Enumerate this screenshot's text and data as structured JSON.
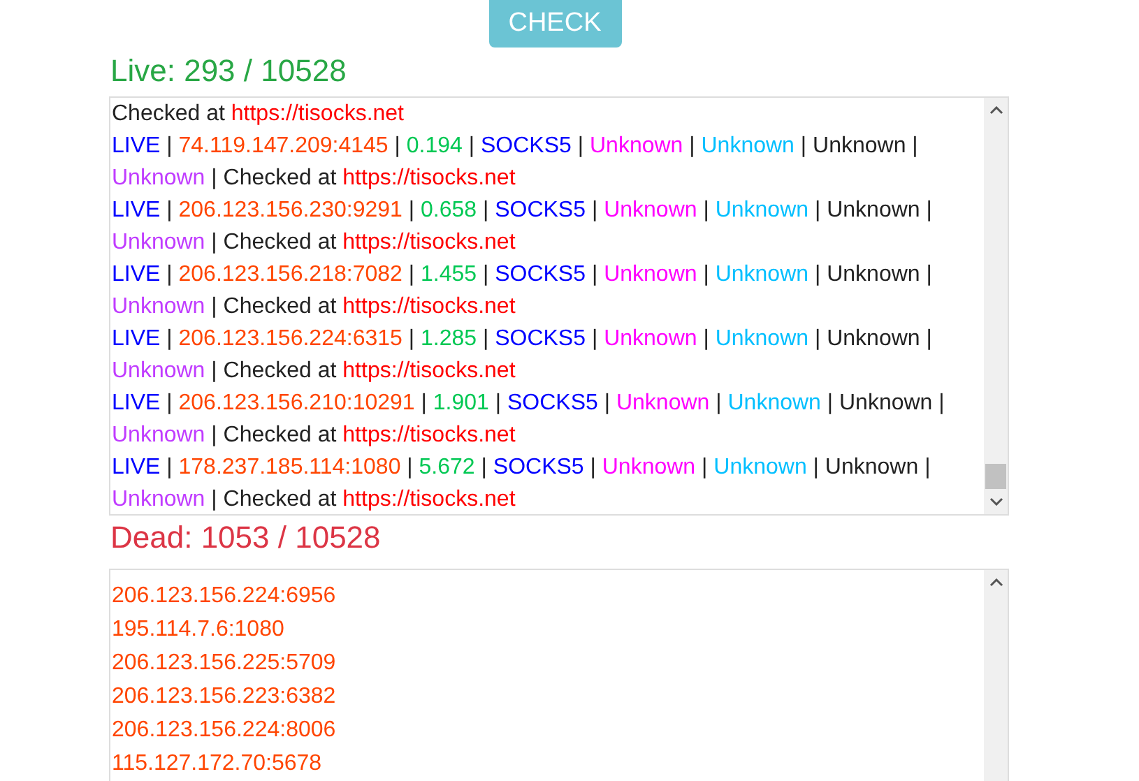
{
  "check_button": "CHECK",
  "live": {
    "heading": "Live: 293 / 10528",
    "separator": "|",
    "partial_tail": {
      "checked_label": "Checked at",
      "source": "https://tisocks.net"
    },
    "entries": [
      {
        "status": "LIVE",
        "address": "74.119.147.209:4145",
        "speed": "0.194",
        "protocol": "SOCKS5",
        "field_5": "Unknown",
        "field_6": "Unknown",
        "field_7": "Unknown",
        "field_8": "Unknown",
        "checked_label": "Checked at",
        "source": "https://tisocks.net"
      },
      {
        "status": "LIVE",
        "address": "206.123.156.230:9291",
        "speed": "0.658",
        "protocol": "SOCKS5",
        "field_5": "Unknown",
        "field_6": "Unknown",
        "field_7": "Unknown",
        "field_8": "Unknown",
        "checked_label": "Checked at",
        "source": "https://tisocks.net"
      },
      {
        "status": "LIVE",
        "address": "206.123.156.218:7082",
        "speed": "1.455",
        "protocol": "SOCKS5",
        "field_5": "Unknown",
        "field_6": "Unknown",
        "field_7": "Unknown",
        "field_8": "Unknown",
        "checked_label": "Checked at",
        "source": "https://tisocks.net"
      },
      {
        "status": "LIVE",
        "address": "206.123.156.224:6315",
        "speed": "1.285",
        "protocol": "SOCKS5",
        "field_5": "Unknown",
        "field_6": "Unknown",
        "field_7": "Unknown",
        "field_8": "Unknown",
        "checked_label": "Checked at",
        "source": "https://tisocks.net"
      },
      {
        "status": "LIVE",
        "address": "206.123.156.210:10291",
        "speed": "1.901",
        "protocol": "SOCKS5",
        "field_5": "Unknown",
        "field_6": "Unknown",
        "field_7": "Unknown",
        "field_8": "Unknown",
        "checked_label": "Checked at",
        "source": "https://tisocks.net"
      },
      {
        "status": "LIVE",
        "address": "178.237.185.114:1080",
        "speed": "5.672",
        "protocol": "SOCKS5",
        "field_5": "Unknown",
        "field_6": "Unknown",
        "field_7": "Unknown",
        "field_8": "Unknown",
        "checked_label": "Checked at",
        "source": "https://tisocks.net"
      }
    ]
  },
  "dead": {
    "heading": "Dead: 1053 / 10528",
    "entries": [
      "206.123.156.224:6956",
      "195.114.7.6:1080",
      "206.123.156.225:5709",
      "206.123.156.223:6382",
      "206.123.156.224:8006",
      "115.127.172.70:5678"
    ]
  }
}
